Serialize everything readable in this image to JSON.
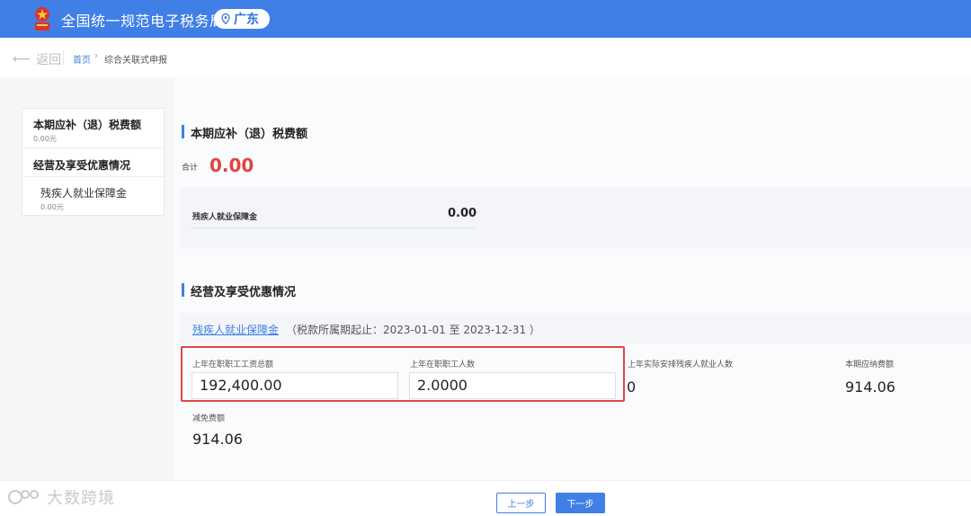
{
  "header": {
    "app_title": "全国统一规范电子税务局",
    "region": "广东",
    "brand_color": "#3f7fe6"
  },
  "breadcrumb": {
    "back_label": "返回",
    "home": "首页",
    "current": "综合关联式申报"
  },
  "sidebar": {
    "items": [
      {
        "label": "本期应补（退）税费额",
        "value": "0.00元"
      },
      {
        "label": "经营及享受优惠情况"
      },
      {
        "label": "残疾人就业保障金",
        "value": "0.00元"
      }
    ]
  },
  "section1": {
    "title": "本期应补（退）税费额",
    "total_label": "合计",
    "total_value": "0.00",
    "fee_label": "残疾人就业保障金",
    "fee_value": "0.00"
  },
  "section2": {
    "title": "经营及享受优惠情况",
    "sub_title": "残疾人就业保障金",
    "period": "（税款所属期起止：2023-01-01 至 2023-12-31 ）",
    "fields": {
      "wage_total_label": "上年在职职工工资总额",
      "wage_total_value": "192,400.00",
      "staff_count_label": "上年在职职工人数",
      "staff_count_value": "2.0000",
      "disabled_count_label": "上年实际安排残疾人就业人数",
      "disabled_count_value": "0",
      "payable_label": "本期应纳费额",
      "payable_value": "914.06",
      "reduction_label": "减免费额",
      "reduction_value": "914.06"
    }
  },
  "footer": {
    "prev_label": "上一步",
    "next_label": "下一步"
  },
  "watermark": {
    "text": "大数跨境"
  },
  "icons": {
    "emblem": "tax-emblem-icon",
    "location": "location-pin-icon",
    "back": "arrow-left-icon"
  }
}
